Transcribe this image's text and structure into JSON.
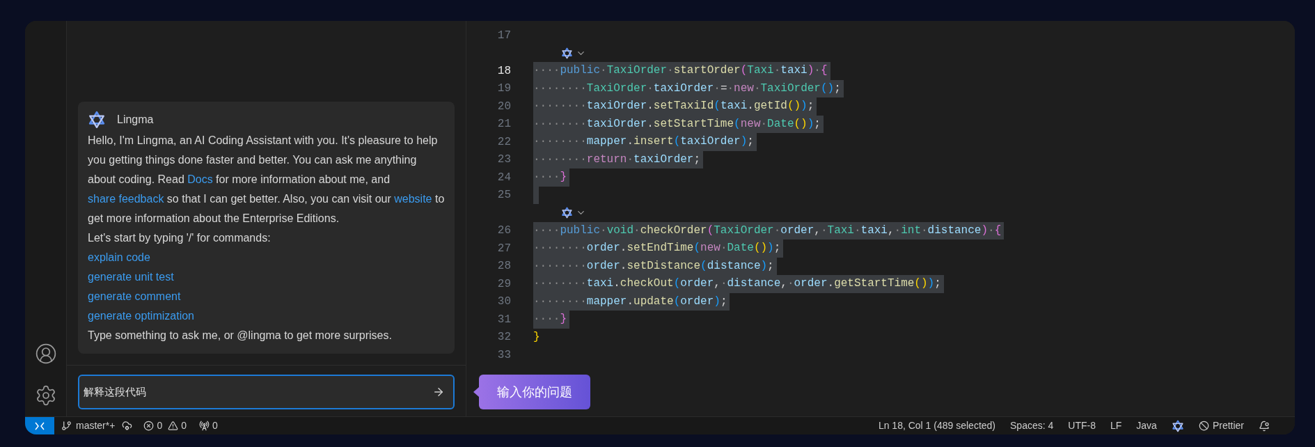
{
  "chat": {
    "assistant_name": "Lingma",
    "message": [
      {
        "kind": "text",
        "text": "Hello, I'm Lingma, an AI Coding Assistant with you. It's pleasure to help you getting things done faster and better. You can ask me anything about coding. Read "
      },
      {
        "kind": "link",
        "text": "Docs"
      },
      {
        "kind": "text",
        "text": " for more information about me, and "
      },
      {
        "kind": "link",
        "text": "share feedback"
      },
      {
        "kind": "text",
        "text": " so that I can get better. Also, you can visit our "
      },
      {
        "kind": "link",
        "text": "website"
      },
      {
        "kind": "text",
        "text": " to get more information about the Enterprise Editions."
      }
    ],
    "commands_intro": "Let's start by typing '/' for commands:",
    "commands": [
      "explain code",
      "generate unit test",
      "generate comment",
      "generate optimization"
    ],
    "footer": "Type something to ask me, or @lingma to get more surprises."
  },
  "input": {
    "value": "解释这段代码"
  },
  "tooltip": "输入你的问题",
  "editor": {
    "lines": [
      {
        "number": "17",
        "selected": false,
        "current": false,
        "lens": false
      },
      {
        "number": "18",
        "selected": true,
        "current": true,
        "lens": true,
        "tokens": [
          {
            "kind": "ws",
            "text": "····"
          },
          {
            "kind": "keyword",
            "text": "public"
          },
          {
            "kind": "ws",
            "text": "·"
          },
          {
            "kind": "type",
            "text": "TaxiOrder"
          },
          {
            "kind": "ws",
            "text": "·"
          },
          {
            "kind": "method",
            "text": "startOrder"
          },
          {
            "kind": "b2",
            "text": "("
          },
          {
            "kind": "type",
            "text": "Taxi"
          },
          {
            "kind": "ws",
            "text": "·"
          },
          {
            "kind": "var",
            "text": "taxi"
          },
          {
            "kind": "b2",
            "text": ")"
          },
          {
            "kind": "ws",
            "text": "·"
          },
          {
            "kind": "b2",
            "text": "{"
          }
        ]
      },
      {
        "number": "19",
        "selected": true,
        "current": false,
        "lens": false,
        "tokens": [
          {
            "kind": "ws",
            "text": "········"
          },
          {
            "kind": "type",
            "text": "TaxiOrder"
          },
          {
            "kind": "ws",
            "text": "·"
          },
          {
            "kind": "var",
            "text": "taxiOrder"
          },
          {
            "kind": "ws",
            "text": "·"
          },
          {
            "kind": "plain",
            "text": "="
          },
          {
            "kind": "ws",
            "text": "·"
          },
          {
            "kind": "control",
            "text": "new"
          },
          {
            "kind": "ws",
            "text": "·"
          },
          {
            "kind": "type",
            "text": "TaxiOrder"
          },
          {
            "kind": "b3",
            "text": "()"
          },
          {
            "kind": "plain",
            "text": ";"
          }
        ]
      },
      {
        "number": "20",
        "selected": true,
        "current": false,
        "lens": false,
        "tokens": [
          {
            "kind": "ws",
            "text": "········"
          },
          {
            "kind": "var",
            "text": "taxiOrder"
          },
          {
            "kind": "plain",
            "text": "."
          },
          {
            "kind": "method",
            "text": "setTaxiId"
          },
          {
            "kind": "b3",
            "text": "("
          },
          {
            "kind": "var",
            "text": "taxi"
          },
          {
            "kind": "plain",
            "text": "."
          },
          {
            "kind": "method",
            "text": "getId"
          },
          {
            "kind": "b1",
            "text": "()"
          },
          {
            "kind": "b3",
            "text": ")"
          },
          {
            "kind": "plain",
            "text": ";"
          }
        ]
      },
      {
        "number": "21",
        "selected": true,
        "current": false,
        "lens": false,
        "tokens": [
          {
            "kind": "ws",
            "text": "········"
          },
          {
            "kind": "var",
            "text": "taxiOrder"
          },
          {
            "kind": "plain",
            "text": "."
          },
          {
            "kind": "method",
            "text": "setStartTime"
          },
          {
            "kind": "b3",
            "text": "("
          },
          {
            "kind": "control",
            "text": "new"
          },
          {
            "kind": "ws",
            "text": "·"
          },
          {
            "kind": "type",
            "text": "Date"
          },
          {
            "kind": "b1",
            "text": "()"
          },
          {
            "kind": "b3",
            "text": ")"
          },
          {
            "kind": "plain",
            "text": ";"
          }
        ]
      },
      {
        "number": "22",
        "selected": true,
        "current": false,
        "lens": false,
        "tokens": [
          {
            "kind": "ws",
            "text": "········"
          },
          {
            "kind": "var",
            "text": "mapper"
          },
          {
            "kind": "plain",
            "text": "."
          },
          {
            "kind": "method",
            "text": "insert"
          },
          {
            "kind": "b3",
            "text": "("
          },
          {
            "kind": "var",
            "text": "taxiOrder"
          },
          {
            "kind": "b3",
            "text": ")"
          },
          {
            "kind": "plain",
            "text": ";"
          }
        ]
      },
      {
        "number": "23",
        "selected": true,
        "current": false,
        "lens": false,
        "tokens": [
          {
            "kind": "ws",
            "text": "········"
          },
          {
            "kind": "control",
            "text": "return"
          },
          {
            "kind": "ws",
            "text": "·"
          },
          {
            "kind": "var",
            "text": "taxiOrder"
          },
          {
            "kind": "plain",
            "text": ";"
          }
        ]
      },
      {
        "number": "24",
        "selected": true,
        "current": false,
        "lens": false,
        "tokens": [
          {
            "kind": "ws",
            "text": "····"
          },
          {
            "kind": "b2",
            "text": "}"
          }
        ]
      },
      {
        "number": "25",
        "selected": true,
        "current": false,
        "lens": false
      },
      {
        "number": "26",
        "selected": true,
        "current": false,
        "lens": true,
        "tokens": [
          {
            "kind": "ws",
            "text": "····"
          },
          {
            "kind": "keyword",
            "text": "public"
          },
          {
            "kind": "ws",
            "text": "·"
          },
          {
            "kind": "type",
            "text": "void"
          },
          {
            "kind": "ws",
            "text": "·"
          },
          {
            "kind": "method",
            "text": "checkOrder"
          },
          {
            "kind": "b2",
            "text": "("
          },
          {
            "kind": "type",
            "text": "TaxiOrder"
          },
          {
            "kind": "ws",
            "text": "·"
          },
          {
            "kind": "var",
            "text": "order"
          },
          {
            "kind": "plain",
            "text": ","
          },
          {
            "kind": "ws",
            "text": "·"
          },
          {
            "kind": "type",
            "text": "Taxi"
          },
          {
            "kind": "ws",
            "text": "·"
          },
          {
            "kind": "var",
            "text": "taxi"
          },
          {
            "kind": "plain",
            "text": ","
          },
          {
            "kind": "ws",
            "text": "·"
          },
          {
            "kind": "type",
            "text": "int"
          },
          {
            "kind": "ws",
            "text": "·"
          },
          {
            "kind": "var",
            "text": "distance"
          },
          {
            "kind": "b2",
            "text": ")"
          },
          {
            "kind": "ws",
            "text": "·"
          },
          {
            "kind": "b2",
            "text": "{"
          }
        ]
      },
      {
        "number": "27",
        "selected": true,
        "current": false,
        "lens": false,
        "tokens": [
          {
            "kind": "ws",
            "text": "········"
          },
          {
            "kind": "var",
            "text": "order"
          },
          {
            "kind": "plain",
            "text": "."
          },
          {
            "kind": "method",
            "text": "setEndTime"
          },
          {
            "kind": "b3",
            "text": "("
          },
          {
            "kind": "control",
            "text": "new"
          },
          {
            "kind": "ws",
            "text": "·"
          },
          {
            "kind": "type",
            "text": "Date"
          },
          {
            "kind": "b1",
            "text": "()"
          },
          {
            "kind": "b3",
            "text": ")"
          },
          {
            "kind": "plain",
            "text": ";"
          }
        ]
      },
      {
        "number": "28",
        "selected": true,
        "current": false,
        "lens": false,
        "tokens": [
          {
            "kind": "ws",
            "text": "········"
          },
          {
            "kind": "var",
            "text": "order"
          },
          {
            "kind": "plain",
            "text": "."
          },
          {
            "kind": "method",
            "text": "setDistance"
          },
          {
            "kind": "b3",
            "text": "("
          },
          {
            "kind": "var",
            "text": "distance"
          },
          {
            "kind": "b3",
            "text": ")"
          },
          {
            "kind": "plain",
            "text": ";"
          }
        ]
      },
      {
        "number": "29",
        "selected": true,
        "current": false,
        "lens": false,
        "tokens": [
          {
            "kind": "ws",
            "text": "········"
          },
          {
            "kind": "var",
            "text": "taxi"
          },
          {
            "kind": "plain",
            "text": "."
          },
          {
            "kind": "method",
            "text": "checkOut"
          },
          {
            "kind": "b3",
            "text": "("
          },
          {
            "kind": "var",
            "text": "order"
          },
          {
            "kind": "plain",
            "text": ","
          },
          {
            "kind": "ws",
            "text": "·"
          },
          {
            "kind": "var",
            "text": "distance"
          },
          {
            "kind": "plain",
            "text": ","
          },
          {
            "kind": "ws",
            "text": "·"
          },
          {
            "kind": "var",
            "text": "order"
          },
          {
            "kind": "plain",
            "text": "."
          },
          {
            "kind": "method",
            "text": "getStartTime"
          },
          {
            "kind": "b1",
            "text": "()"
          },
          {
            "kind": "b3",
            "text": ")"
          },
          {
            "kind": "plain",
            "text": ";"
          }
        ]
      },
      {
        "number": "30",
        "selected": true,
        "current": false,
        "lens": false,
        "tokens": [
          {
            "kind": "ws",
            "text": "········"
          },
          {
            "kind": "var",
            "text": "mapper"
          },
          {
            "kind": "plain",
            "text": "."
          },
          {
            "kind": "method",
            "text": "update"
          },
          {
            "kind": "b3",
            "text": "("
          },
          {
            "kind": "var",
            "text": "order"
          },
          {
            "kind": "b3",
            "text": ")"
          },
          {
            "kind": "plain",
            "text": ";"
          }
        ]
      },
      {
        "number": "31",
        "selected": true,
        "current": false,
        "lens": false,
        "tokens": [
          {
            "kind": "ws",
            "text": "····"
          },
          {
            "kind": "b2",
            "text": "}"
          }
        ]
      },
      {
        "number": "32",
        "selected": false,
        "current": false,
        "lens": false,
        "tokens": [
          {
            "kind": "b1",
            "text": "}"
          }
        ]
      },
      {
        "number": "33",
        "selected": false,
        "current": false,
        "lens": false
      }
    ]
  },
  "status_bar": {
    "branch": "master*+",
    "errors": "0",
    "warnings": "0",
    "ports": "0",
    "position": "Ln 18, Col 1 (489 selected)",
    "indent": "Spaces: 4",
    "encoding": "UTF-8",
    "eol": "LF",
    "language": "Java",
    "formatter": "Prettier"
  }
}
